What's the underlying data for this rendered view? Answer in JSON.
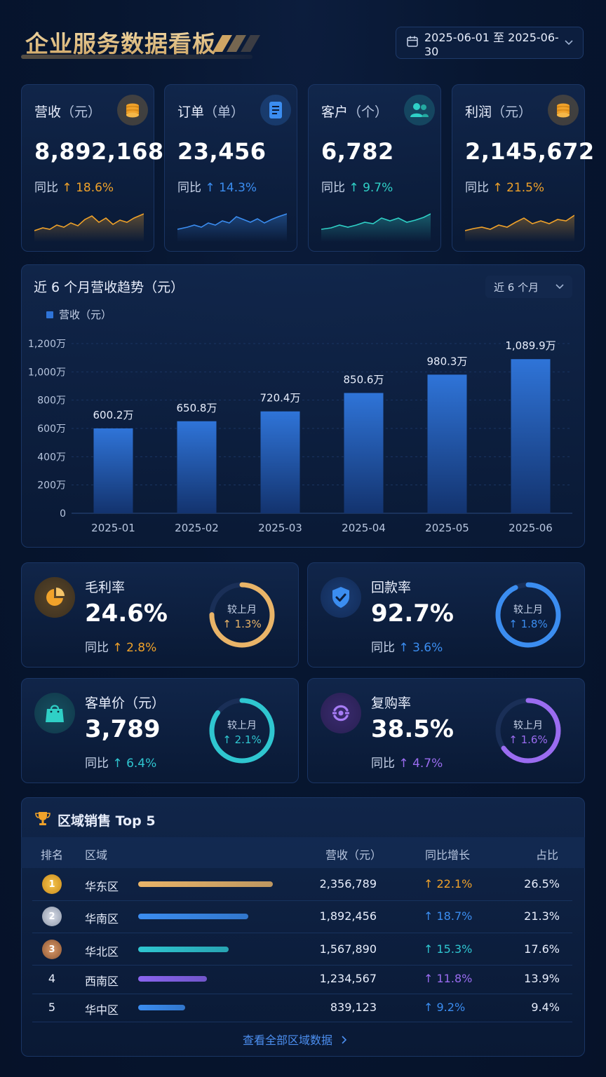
{
  "header": {
    "title": "企业服务数据看板",
    "date_range": "2025-06-01 至 2025-06-30"
  },
  "kpis": [
    {
      "label": "营收",
      "unit": "（元）",
      "value": "8,892,168",
      "yoy_label": "同比",
      "yoy": "18.6%",
      "color": "#f0a22a",
      "icon": "coins-icon"
    },
    {
      "label": "订单",
      "unit": "（单）",
      "value": "23,456",
      "yoy_label": "同比",
      "yoy": "14.3%",
      "color": "#3b8df0",
      "icon": "document-icon"
    },
    {
      "label": "客户",
      "unit": "（个）",
      "value": "6,782",
      "yoy_label": "同比",
      "yoy": "9.7%",
      "color": "#2fd0c6",
      "icon": "users-icon"
    },
    {
      "label": "利润",
      "unit": "（元）",
      "value": "2,145,672",
      "yoy_label": "同比",
      "yoy": "21.5%",
      "color": "#f0a22a",
      "icon": "coins-icon"
    }
  ],
  "chart_section": {
    "title": "近 6 个月营收趋势（元）",
    "range": "近 6 个月",
    "legend": "营收（元）"
  },
  "chart_data": {
    "type": "bar",
    "categories": [
      "2025-01",
      "2025-02",
      "2025-03",
      "2025-04",
      "2025-05",
      "2025-06"
    ],
    "values": [
      600.2,
      650.8,
      720.4,
      850.6,
      980.3,
      1089.9
    ],
    "value_labels": [
      "600.2万",
      "650.8万",
      "720.4万",
      "850.6万",
      "980.3万",
      "1,089.9万"
    ],
    "yticks": [
      "0",
      "200万",
      "400万",
      "600万",
      "800万",
      "1,000万",
      "1,200万"
    ],
    "ylim": [
      0,
      1200
    ],
    "series_name": "营收（元）",
    "color": "#2f74d8"
  },
  "metrics": [
    {
      "label": "毛利率",
      "value": "24.6%",
      "yoy_label": "同比",
      "yoy": "2.8%",
      "ring_label": "较上月",
      "ring_value": "1.3%",
      "color": "#e9b468",
      "ring_fill": 0.75,
      "icon": "pie-chart-icon"
    },
    {
      "label": "回款率",
      "value": "92.7%",
      "yoy_label": "同比",
      "yoy": "3.6%",
      "ring_label": "较上月",
      "ring_value": "1.8%",
      "color": "#3b8df0",
      "ring_fill": 0.93,
      "icon": "shield-check-icon"
    },
    {
      "label": "客单价（元）",
      "value": "3,789",
      "yoy_label": "同比",
      "yoy": "6.4%",
      "ring_label": "较上月",
      "ring_value": "2.1%",
      "color": "#2fc6d0",
      "ring_fill": 0.85,
      "icon": "shopping-bag-icon"
    },
    {
      "label": "复购率",
      "value": "38.5%",
      "yoy_label": "同比",
      "yoy": "4.7%",
      "ring_label": "较上月",
      "ring_value": "1.6%",
      "color": "#9a6cf0",
      "ring_fill": 0.65,
      "icon": "repeat-icon"
    }
  ],
  "region_table": {
    "title": "区域销售 Top 5",
    "headers": [
      "排名",
      "区域",
      "营收（元）",
      "同比增长",
      "占比"
    ],
    "rows": [
      {
        "rank": "1",
        "region": "华东区",
        "revenue": "2,356,789",
        "growth": "22.1%",
        "share": "26.5%",
        "bar_fill": 1.0,
        "color": "#e9b468"
      },
      {
        "rank": "2",
        "region": "华南区",
        "revenue": "1,892,456",
        "growth": "18.7%",
        "share": "21.3%",
        "bar_fill": 0.82,
        "color": "#3b8df0"
      },
      {
        "rank": "3",
        "region": "华北区",
        "revenue": "1,567,890",
        "growth": "15.3%",
        "share": "17.6%",
        "bar_fill": 0.67,
        "color": "#2fc6d0"
      },
      {
        "rank": "4",
        "region": "西南区",
        "revenue": "1,234,567",
        "growth": "11.8%",
        "share": "13.9%",
        "bar_fill": 0.51,
        "color": "#8a64ee"
      },
      {
        "rank": "5",
        "region": "华中区",
        "revenue": "839,123",
        "growth": "9.2%",
        "share": "9.4%",
        "bar_fill": 0.35,
        "color": "#3b8df0"
      }
    ],
    "view_all": "查看全部区域数据"
  }
}
